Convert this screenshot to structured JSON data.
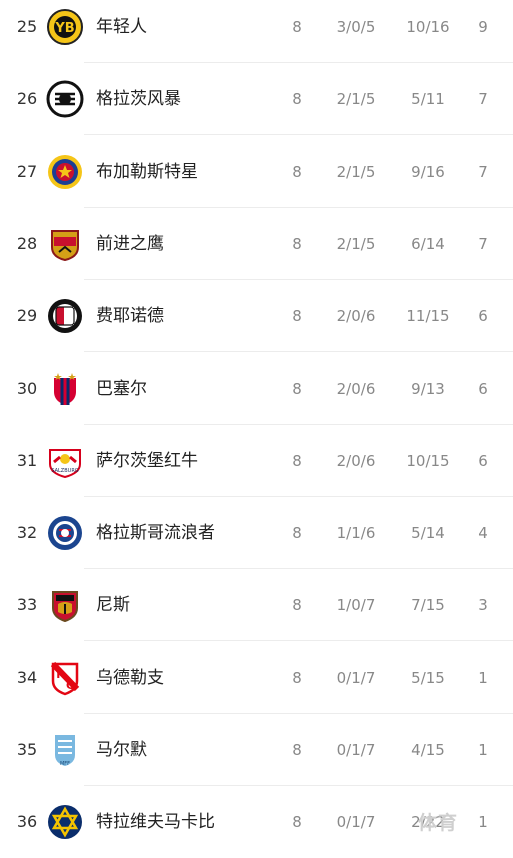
{
  "standings": [
    {
      "rank": "25",
      "team": "年轻人",
      "played": "8",
      "wdl": "3/0/5",
      "goals": "10/16",
      "points": "9",
      "logo": "young-boys-logo",
      "color": "#f5c518"
    },
    {
      "rank": "26",
      "team": "格拉茨风暴",
      "played": "8",
      "wdl": "2/1/5",
      "goals": "5/11",
      "points": "7",
      "logo": "sturm-graz-logo",
      "color": "#111111"
    },
    {
      "rank": "27",
      "team": "布加勒斯特星",
      "played": "8",
      "wdl": "2/1/5",
      "goals": "9/16",
      "points": "7",
      "logo": "fcsb-logo",
      "color": "#c8102e"
    },
    {
      "rank": "28",
      "team": "前进之鹰",
      "played": "8",
      "wdl": "2/1/5",
      "goals": "6/14",
      "points": "7",
      "logo": "go-ahead-eagles-logo",
      "color": "#d4a017"
    },
    {
      "rank": "29",
      "team": "费耶诺德",
      "played": "8",
      "wdl": "2/0/6",
      "goals": "11/15",
      "points": "6",
      "logo": "feyenoord-logo",
      "color": "#c8102e"
    },
    {
      "rank": "30",
      "team": "巴塞尔",
      "played": "8",
      "wdl": "2/0/6",
      "goals": "9/13",
      "points": "6",
      "logo": "basel-logo",
      "color": "#d50032"
    },
    {
      "rank": "31",
      "team": "萨尔茨堡红牛",
      "played": "8",
      "wdl": "2/0/6",
      "goals": "10/15",
      "points": "6",
      "logo": "salzburg-logo",
      "color": "#d6001c"
    },
    {
      "rank": "32",
      "team": "格拉斯哥流浪者",
      "played": "8",
      "wdl": "1/1/6",
      "goals": "5/14",
      "points": "4",
      "logo": "rangers-logo",
      "color": "#1b458f"
    },
    {
      "rank": "33",
      "team": "尼斯",
      "played": "8",
      "wdl": "1/0/7",
      "goals": "7/15",
      "points": "3",
      "logo": "nice-logo",
      "color": "#c8102e"
    },
    {
      "rank": "34",
      "team": "乌德勒支",
      "played": "8",
      "wdl": "0/1/7",
      "goals": "5/15",
      "points": "1",
      "logo": "utrecht-logo",
      "color": "#e30613"
    },
    {
      "rank": "35",
      "team": "马尔默",
      "played": "8",
      "wdl": "0/1/7",
      "goals": "4/15",
      "points": "1",
      "logo": "malmo-logo",
      "color": "#7ab8e0"
    },
    {
      "rank": "36",
      "team": "特拉维夫马卡比",
      "played": "8",
      "wdl": "0/1/7",
      "goals": "2/22",
      "points": "1",
      "logo": "maccabi-tel-aviv-logo",
      "color": "#f4c300"
    }
  ],
  "watermark": "体育"
}
